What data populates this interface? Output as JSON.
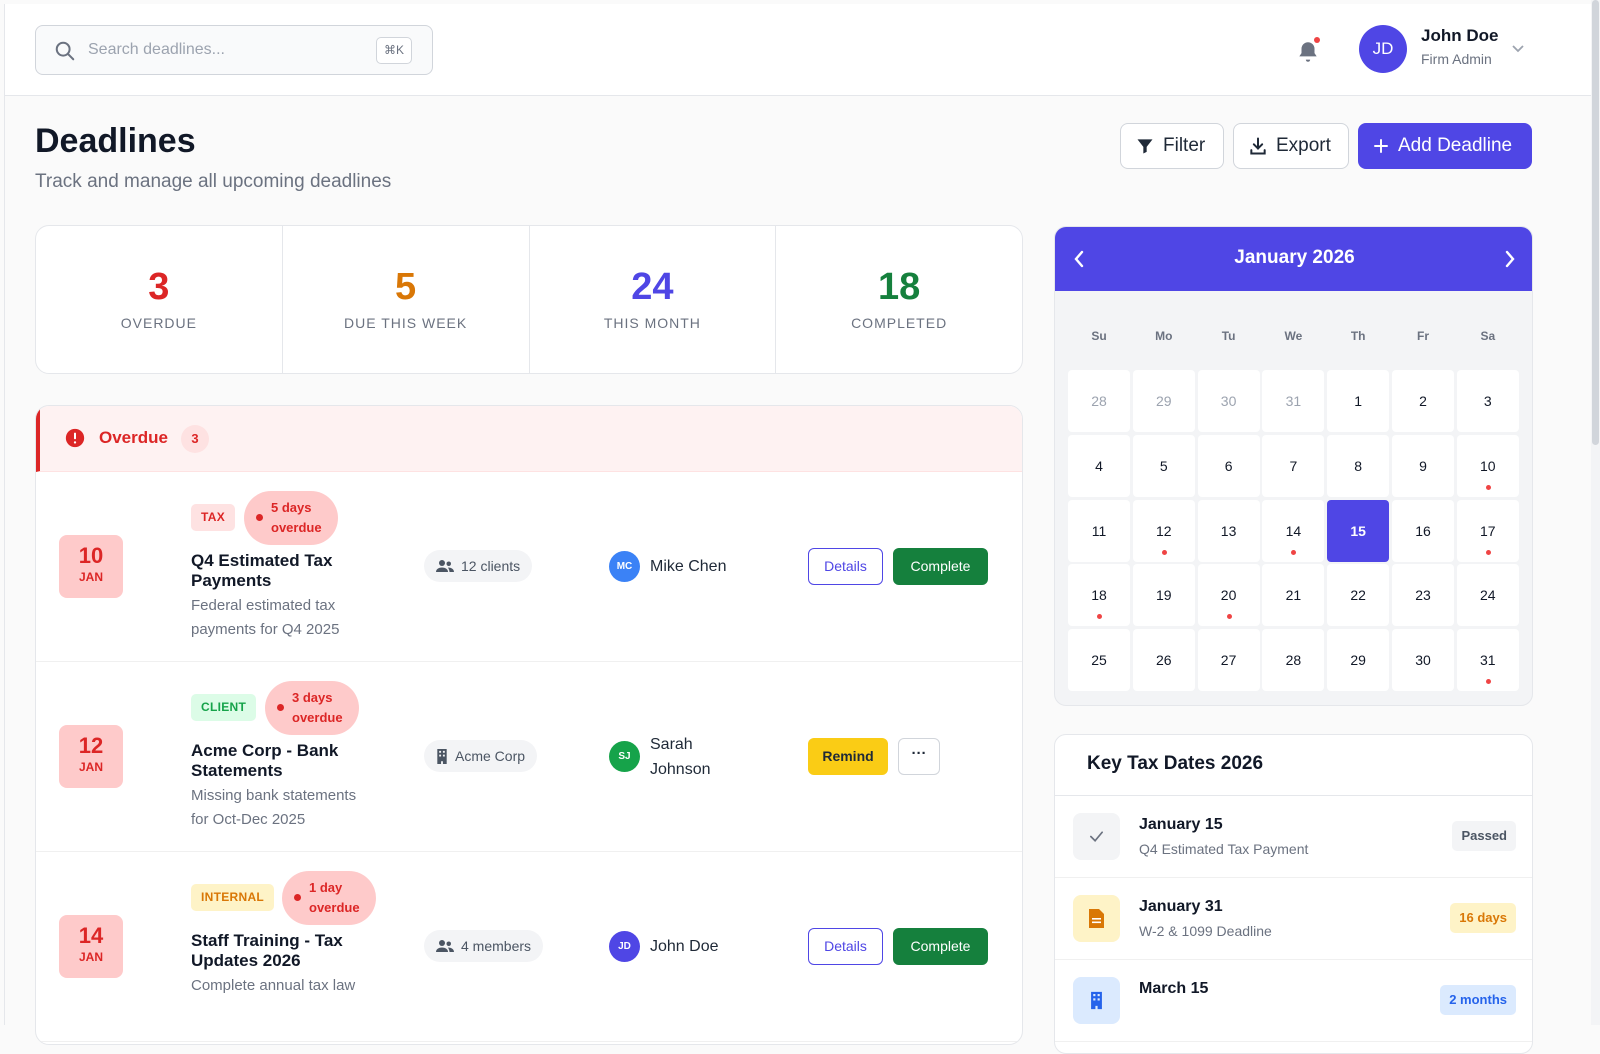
{
  "search": {
    "placeholder": "Search deadlines...",
    "shortcut": "⌘K"
  },
  "user": {
    "initials": "JD",
    "name": "John Doe",
    "role": "Firm Admin"
  },
  "page": {
    "title": "Deadlines",
    "subtitle": "Track and manage all upcoming deadlines"
  },
  "actions": {
    "filter": "Filter",
    "export": "Export",
    "add": "Add Deadline"
  },
  "stats": [
    {
      "value": "3",
      "label": "OVERDUE",
      "color": "#dc2626"
    },
    {
      "value": "5",
      "label": "DUE THIS WEEK",
      "color": "#d97706"
    },
    {
      "value": "24",
      "label": "THIS MONTH",
      "color": "#4f46e5"
    },
    {
      "value": "18",
      "label": "COMPLETED",
      "color": "#15803d"
    }
  ],
  "overdue": {
    "title": "Overdue",
    "count": "3",
    "items": [
      {
        "day": "10",
        "month": "JAN",
        "tag": "TAX",
        "overdue_line1": "5 days",
        "overdue_line2": "overdue",
        "title_line1": "Q4 Estimated Tax",
        "title_line2": "Payments",
        "desc_line1": "Federal estimated tax",
        "desc_line2": "payments for Q4 2025",
        "scope": "12 clients",
        "assignee_initials": "MC",
        "assignee_line1": "Mike Chen",
        "assignee_line2": "",
        "details": "Details",
        "complete": "Complete"
      },
      {
        "day": "12",
        "month": "JAN",
        "tag": "CLIENT",
        "overdue_line1": "3 days",
        "overdue_line2": "overdue",
        "title_line1": "Acme Corp - Bank",
        "title_line2": "Statements",
        "desc_line1": "Missing bank statements",
        "desc_line2": "for Oct-Dec 2025",
        "scope": "Acme Corp",
        "assignee_initials": "SJ",
        "assignee_line1": "Sarah",
        "assignee_line2": "Johnson",
        "remind": "Remind",
        "more": "···"
      },
      {
        "day": "14",
        "month": "JAN",
        "tag": "INTERNAL",
        "overdue_line1": "1 day",
        "overdue_line2": "overdue",
        "title_line1": "Staff Training - Tax",
        "title_line2": "Updates 2026",
        "desc_line1": "Complete annual tax law",
        "desc_line2": "",
        "scope": "4 members",
        "assignee_initials": "JD",
        "assignee_line1": "John Doe",
        "assignee_line2": "",
        "details": "Details",
        "complete": "Complete"
      }
    ]
  },
  "calendar": {
    "title": "January 2026",
    "weekdays": [
      "Su",
      "Mo",
      "Tu",
      "We",
      "Th",
      "Fr",
      "Sa"
    ],
    "leading_days": [
      "28",
      "29",
      "30",
      "31"
    ],
    "days_in_month": 31,
    "selected_day": 15,
    "event_days": [
      10,
      12,
      14,
      17,
      18,
      20,
      31
    ]
  },
  "key_dates": {
    "title": "Key Tax Dates 2026",
    "items": [
      {
        "date": "January 15",
        "desc": "Q4 Estimated Tax Payment",
        "badge": "Passed",
        "icon": "check-icon"
      },
      {
        "date": "January 31",
        "desc": "W-2 & 1099 Deadline",
        "badge": "16 days",
        "icon": "document-icon"
      },
      {
        "date": "March 15",
        "desc": "",
        "badge": "2 months",
        "icon": "building-icon"
      }
    ]
  }
}
